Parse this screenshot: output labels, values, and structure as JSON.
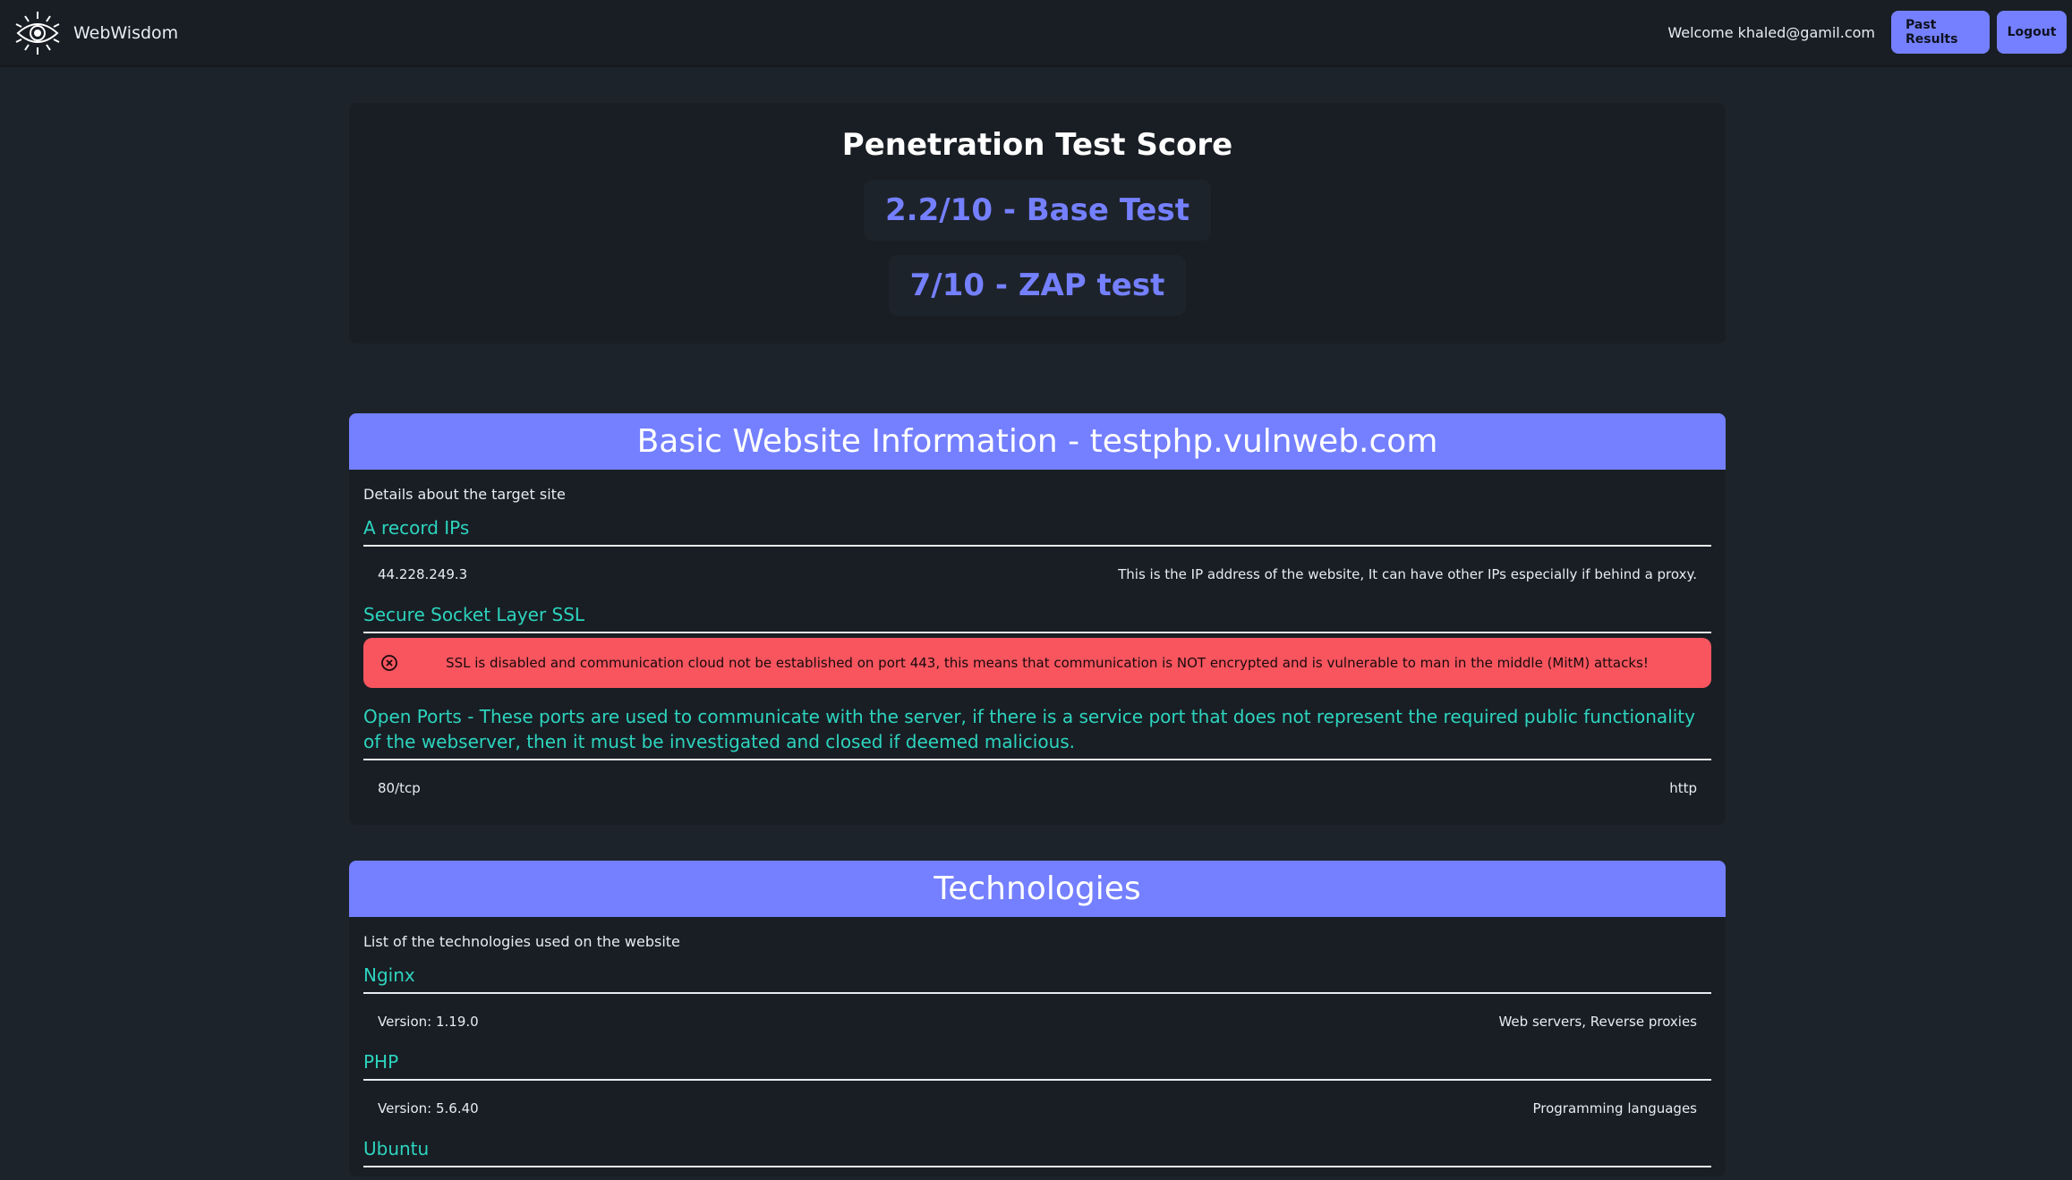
{
  "navbar": {
    "brand": "WebWisdom",
    "welcome": "Welcome khaled@gamil.com",
    "past_results": "Past Results",
    "logout": "Logout"
  },
  "score": {
    "title": "Penetration Test Score",
    "base_test": "2.2/10 - Base Test",
    "zap_test": "7/10 - ZAP test"
  },
  "basic_info": {
    "header": "Basic Website Information - testphp.vulnweb.com",
    "description": "Details about the target site",
    "a_record": {
      "title": "A record IPs",
      "ip": "44.228.249.3",
      "note": "This is the IP address of the website, It can have other IPs especially if behind a proxy."
    },
    "ssl": {
      "title": "Secure Socket Layer SSL",
      "alert": "SSL is disabled and communication cloud not be established on port 443, this means that communication is NOT encrypted and is vulnerable to man in the middle (MitM) attacks!"
    },
    "ports": {
      "title": "Open Ports - These ports are used to communicate with the server, if there is a service port that does not represent the required public functionality of the webserver, then it must be investigated and closed if deemed malicious.",
      "items": [
        {
          "port": "80/tcp",
          "service": "http"
        }
      ]
    }
  },
  "technologies": {
    "header": "Technologies",
    "description": "List of the technologies used on the website",
    "items": [
      {
        "name": "Nginx",
        "version": "Version: 1.19.0",
        "category": "Web servers, Reverse proxies"
      },
      {
        "name": "PHP",
        "version": "Version: 5.6.40",
        "category": "Programming languages"
      },
      {
        "name": "Ubuntu"
      }
    ]
  },
  "colors": {
    "primary": "#7480ff",
    "accent": "#2dd4bf",
    "error": "#f8555f",
    "background": "#1d232a"
  },
  "icons": {
    "brand": "eye-logo-icon",
    "alert": "circle-x-icon"
  }
}
